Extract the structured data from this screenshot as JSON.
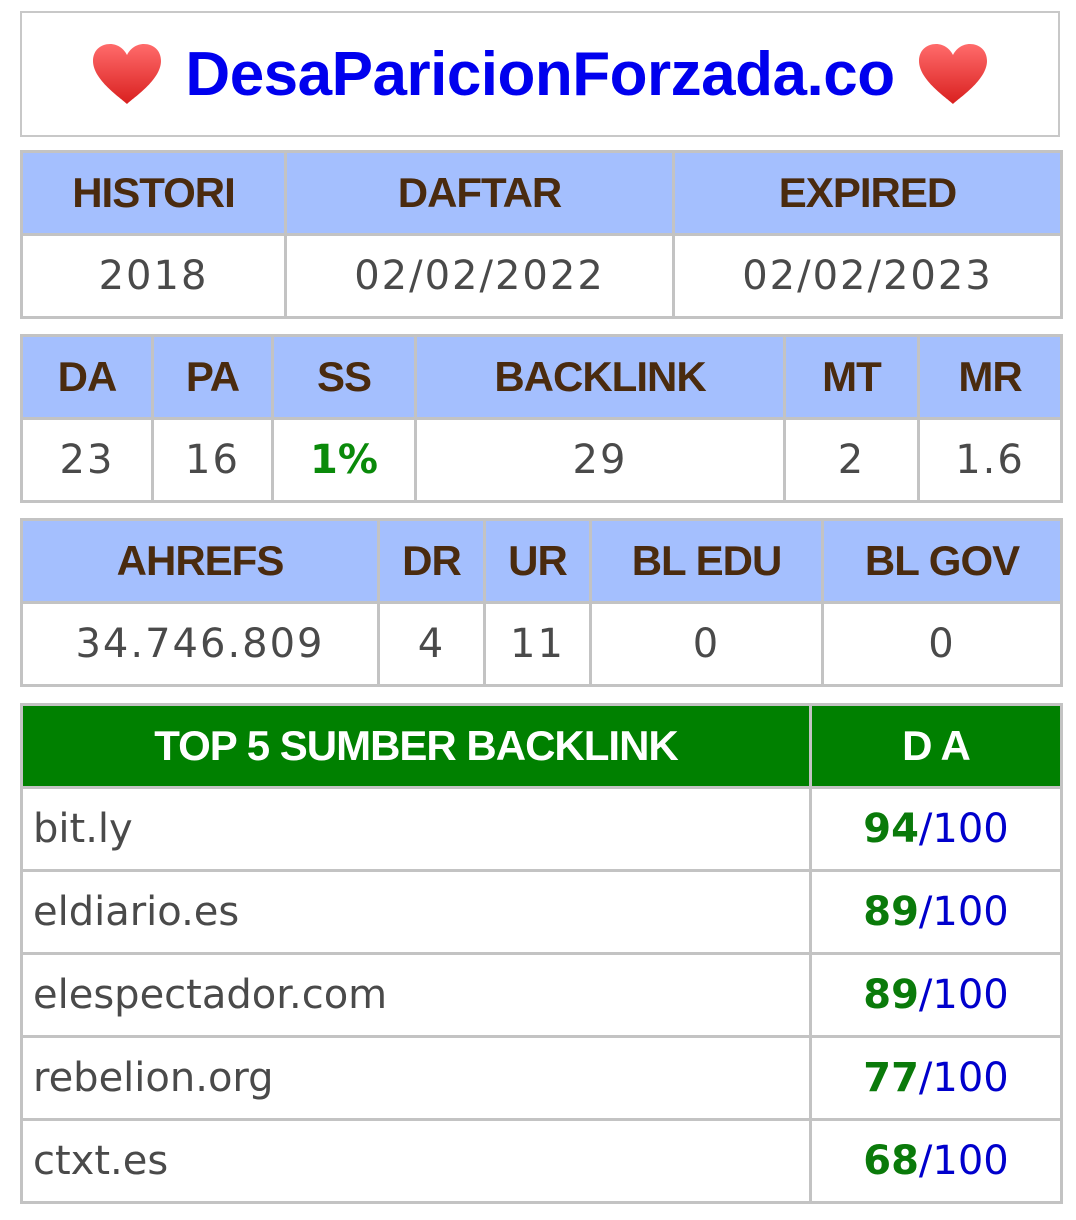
{
  "title": "DesaParicionForzada.co",
  "icons": {
    "heart_left": "heart-icon",
    "heart_right": "heart-icon"
  },
  "colors": {
    "title": "#0000ee",
    "header_bg": "#a4bffe",
    "header_text": "#4a2b0f",
    "top_header_bg": "#008000",
    "good": "#0a8a0a",
    "max": "#0000cc"
  },
  "domain_info": {
    "headers": [
      "HISTORI",
      "DAFTAR",
      "EXPIRED"
    ],
    "values": [
      "2018",
      "02/02/2022",
      "02/02/2023"
    ]
  },
  "moz": {
    "headers": [
      "DA",
      "PA",
      "SS",
      "BACKLINK",
      "MT",
      "MR"
    ],
    "values": [
      "23",
      "16",
      "1%",
      "29",
      "2",
      "1.6"
    ]
  },
  "ahrefs": {
    "headers": [
      "AHREFS",
      "DR",
      "UR",
      "BL EDU",
      "BL GOV"
    ],
    "values": [
      "34.746.809",
      "4",
      "11",
      "0",
      "0"
    ]
  },
  "top_backlinks": {
    "header_source": "TOP 5 SUMBER BACKLINK",
    "header_da": "D A",
    "separator": "/",
    "max": "100",
    "rows": [
      {
        "site": "bit.ly",
        "da": "94"
      },
      {
        "site": "eldiario.es",
        "da": "89"
      },
      {
        "site": "elespectador.com",
        "da": "89"
      },
      {
        "site": "rebelion.org",
        "da": "77"
      },
      {
        "site": "ctxt.es",
        "da": "68"
      }
    ]
  }
}
